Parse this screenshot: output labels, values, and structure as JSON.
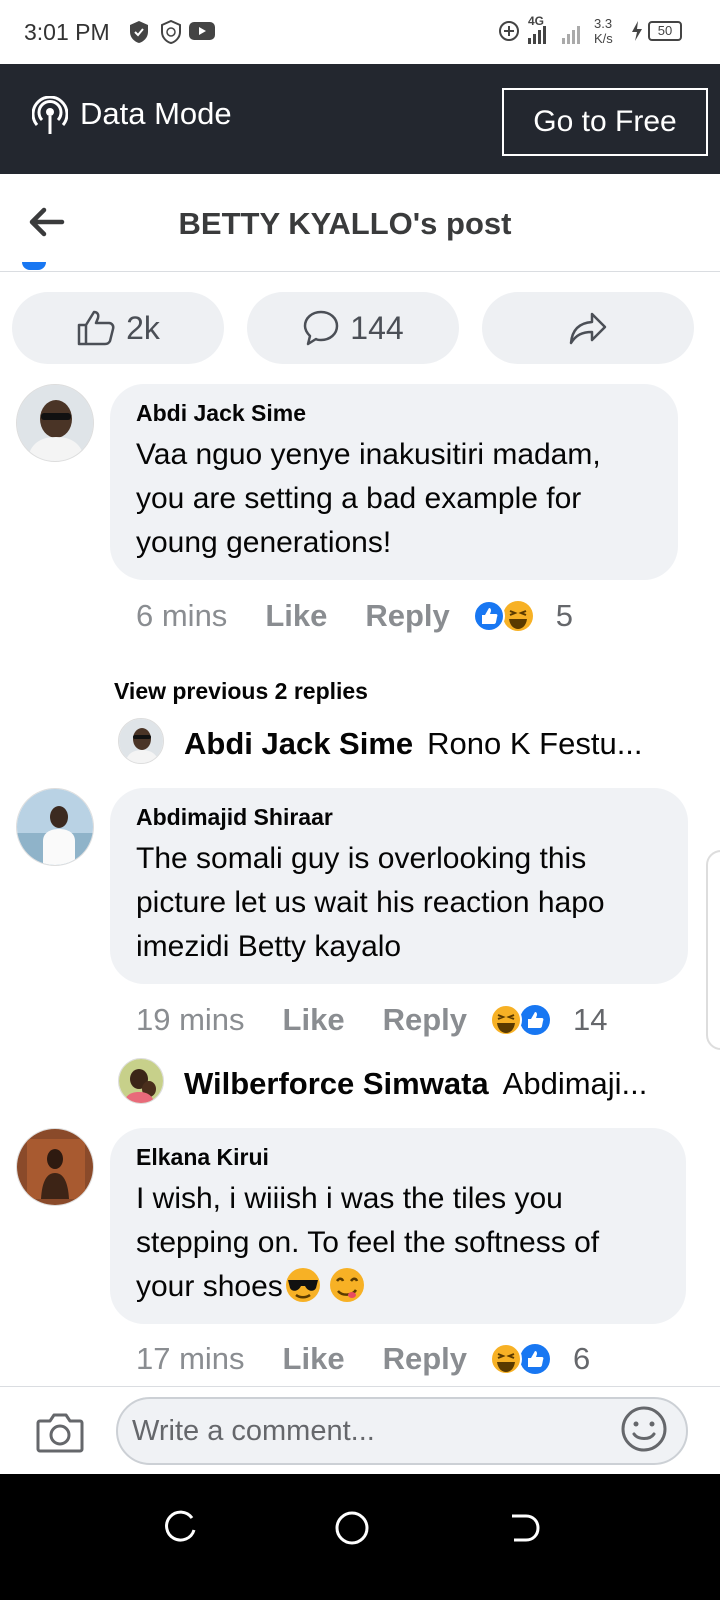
{
  "status_bar": {
    "time": "3:01 PM",
    "network": "4G",
    "speed": "3.3 K/s",
    "battery": "50"
  },
  "data_bar": {
    "label": "Data Mode",
    "go_free": "Go to Free"
  },
  "header": {
    "title": "BETTY KYALLO's post"
  },
  "actions": {
    "likes": "2k",
    "comments": "144"
  },
  "comments": [
    {
      "author": "Abdi Jack Sime",
      "text": "Vaa nguo yenye inakusitiri madam, you are setting a bad example for young generations!",
      "time": "6 mins",
      "like": "Like",
      "reply": "Reply",
      "reaction_count": "5"
    },
    {
      "author": "Abdimajid Shiraar",
      "text": "The somali guy is overlooking this picture let us wait his reaction hapo imezidi Betty kayalo",
      "time": "19 mins",
      "like": "Like",
      "reply": "Reply",
      "reaction_count": "14"
    },
    {
      "author": "Elkana Kirui",
      "text": "I wish, i wiiish i was the tiles you stepping on. To feel the softness of your shoes",
      "time": "17 mins",
      "like": "Like",
      "reply": "Reply",
      "reaction_count": "6"
    }
  ],
  "view_previous": "View previous 2 replies",
  "replies": [
    {
      "author": "Abdi Jack Sime",
      "text": "Rono K Festu..."
    },
    {
      "author": "Wilberforce Simwata",
      "text": "Abdimaji..."
    }
  ],
  "composer": {
    "placeholder": "Write a comment..."
  },
  "colors": {
    "brand_dark": "#23272f",
    "bubble": "#f0f2f5",
    "like_blue": "#1877f2",
    "haha_yellow": "#f7b125"
  }
}
